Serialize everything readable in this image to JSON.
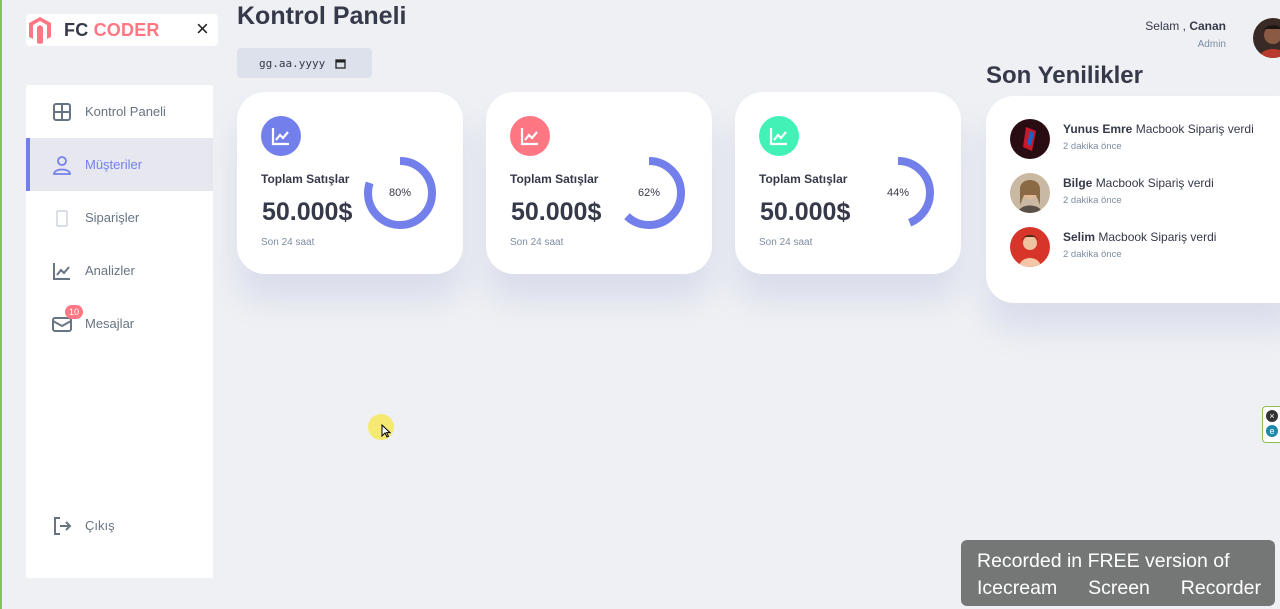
{
  "brand": {
    "prefix": "FC",
    "accent": "CODER",
    "close_icon": "×"
  },
  "sidebar": {
    "items": [
      {
        "label": "Kontrol Paneli",
        "icon": "grid-icon"
      },
      {
        "label": "Müşteriler",
        "icon": "person-icon",
        "active": true
      },
      {
        "label": "Siparişler",
        "icon": "document-icon"
      },
      {
        "label": "Analizler",
        "icon": "chart-icon"
      },
      {
        "label": "Mesajlar",
        "icon": "mail-icon",
        "badge": "10"
      }
    ],
    "logout_label": "Çıkış"
  },
  "main": {
    "title": "Kontrol Paneli",
    "date_placeholder": "gg.aa.yyyy"
  },
  "cards": [
    {
      "title": "Toplam Satışlar",
      "value": "50.000$",
      "subtitle": "Son 24 saat",
      "percent_label": "80%",
      "percent": 80,
      "color": "#7380ec"
    },
    {
      "title": "Toplam Satışlar",
      "value": "50.000$",
      "subtitle": "Son 24 saat",
      "percent_label": "62%",
      "percent": 62,
      "color": "#ff7782"
    },
    {
      "title": "Toplam Satışlar",
      "value": "50.000$",
      "subtitle": "Son 24 saat",
      "percent_label": "44%",
      "percent": 44,
      "color": "#41f1b6"
    }
  ],
  "header": {
    "greeting": "Selam ,",
    "user_name": "Canan",
    "role": "Admin"
  },
  "updates": {
    "title": "Son Yenilikler",
    "items": [
      {
        "name": "Yunus Emre",
        "message": "Macbook Sipariş verdi",
        "time": "2 dakika önce"
      },
      {
        "name": "Bilge",
        "message": "Macbook Sipariş verdi",
        "time": "2 dakika önce"
      },
      {
        "name": "Selim",
        "message": "Macbook Sipariş verdi",
        "time": "2 dakika önce"
      }
    ]
  },
  "watermark": {
    "line1": "Recorded in FREE version of",
    "line2": [
      "Icecream",
      "Screen",
      "Recorder"
    ]
  },
  "colors": {
    "primary": "#7380ec",
    "danger": "#ff7782",
    "success": "#41f1b6",
    "background": "#eef0f4"
  }
}
